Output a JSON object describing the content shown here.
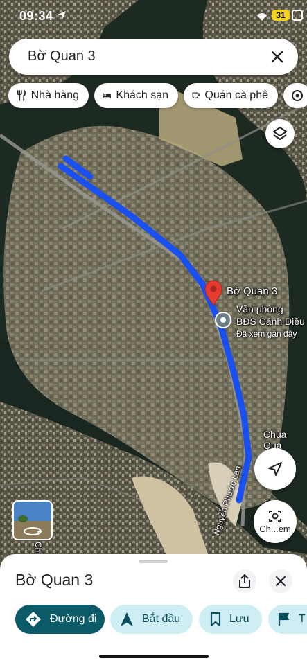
{
  "status_bar": {
    "time": "09:34",
    "battery": "31"
  },
  "search": {
    "query": "Bờ Quan 3"
  },
  "chips": [
    {
      "label": "Nhà hàng",
      "icon": "restaurant-icon"
    },
    {
      "label": "Khách sạn",
      "icon": "hotel-icon"
    },
    {
      "label": "Quán cà phê",
      "icon": "coffee-icon"
    },
    {
      "label": "",
      "icon": "attractions-icon"
    }
  ],
  "map": {
    "pin_label": "Bờ Quan 3",
    "place_label_line1": "Văn phòng",
    "place_label_line2": "BĐS Cánh Diều",
    "place_sublabel": "Đã xem gần đây",
    "temple_label": "Chùa Qua",
    "street_label": "Nguyễn Phước Lan",
    "side_text": "Chi"
  },
  "controls": {
    "lens_label": "Ch...em"
  },
  "sheet": {
    "title": "Bờ Quan 3",
    "actions": [
      {
        "label": "Đường đi",
        "icon": "directions-icon"
      },
      {
        "label": "Bắt đầu",
        "icon": "navigation-icon"
      },
      {
        "label": "Lưu",
        "icon": "bookmark-icon"
      },
      {
        "label": "T",
        "icon": "flag-icon"
      }
    ]
  },
  "colors": {
    "route": "#1a4ff0",
    "pin": "#e33b2f",
    "primary": "#0b5a68",
    "secondary_bg": "#cfeef3",
    "secondary_fg": "#0b4f5c"
  }
}
